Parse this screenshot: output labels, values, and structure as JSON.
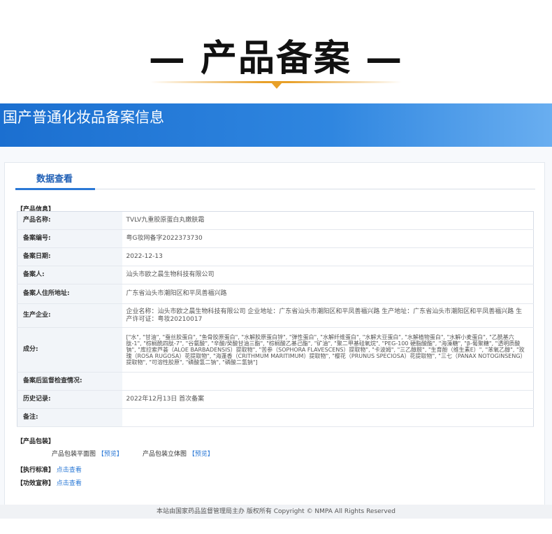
{
  "hero": {
    "title": "— 产品备案 —"
  },
  "banner": {
    "title": "国产普通化妆品备案信息"
  },
  "tab": {
    "label": "数据查看"
  },
  "product_section": {
    "label": "【产品信息】"
  },
  "table": [
    {
      "key": "产品名称:",
      "value": "TVLV九重胶原蛋白丸嫩肤霜"
    },
    {
      "key": "备案编号:",
      "value": "粤G妆网备字2022373730"
    },
    {
      "key": "备案日期:",
      "value": "2022-12-13"
    },
    {
      "key": "备案人:",
      "value": "汕头市欧之晨生物科技有限公司"
    },
    {
      "key": "备案人住所地址:",
      "value": "广东省汕头市潮阳区和平凤善福兴路"
    },
    {
      "key": "生产企业:",
      "value": "企业名称：汕头市欧之晨生物科技有限公司 企业地址：广东省汕头市潮阳区和平凤善福兴路 生产地址：广东省汕头市潮阳区和平凤善福兴路 生产许可证：粤妆20210017"
    },
    {
      "key": "成分:",
      "value": "[\"水\", \"甘油\", \"蚕丝胶蛋白\", \"鱼骨胶原蛋白\", \"水解胶原蛋白锌\", \"弹性蛋白\", \"水解纤维蛋白\", \"水解大豆蛋白\", \"水解植物蛋白\", \"水解小麦蛋白\", \"乙酰基六肽-1\", \"棕榈酰四肽-7\", \"谷氨酸\", \"辛酸/癸酸甘油三酯\", \"棕榈酸乙基己酯\", \"矿油\", \"聚二甲基硅氧烷\", \"PEG-100 硬脂酸酯\", \"海藻糖\", \"β-葡聚糖\", \"透明质酸钠\", \"库拉索芦荟（ALOE BARBADENSIS）提取物\", \"苦参（SOPHORA FLAVESCENS）提取物\", \"卡波姆\", \"三乙醇胺\", \"生育酚（维生素E）\", \"苯氧乙醇\", \"玫瑰（ROSA RUGOSA）花提取物\", \"海蓬香（CRITHMUM MARITIMUM）提取物\", \"樱花（PRUNUS SPECIOSA）花提取物\", \"三七（PANAX NOTOGINSENG）提取物\", \"可溶性胶原\", \"磷酸氢二钠\", \"磷酸二氢钠\"]"
    },
    {
      "key": "备案后监督检查情况:",
      "value": ""
    },
    {
      "key": "历史记录:",
      "value": "2022年12月13日 首次备案"
    },
    {
      "key": "备注:",
      "value": ""
    }
  ],
  "packaging": {
    "label": "【产品包装】",
    "flat_label": "产品包装平面图",
    "flat_link": "【预览】",
    "solid_label": "产品包装立体图",
    "solid_link": "【预览】"
  },
  "standard": {
    "label": "【执行标准】",
    "link": "点击查看"
  },
  "efficacy": {
    "label": "【功效宣称】",
    "link": "点击查看"
  },
  "footer": {
    "text": "本站由国家药品监督管理局主办 版权所有 Copyright © NMPA All Rights Reserved"
  },
  "colors": {
    "accent": "#e8a028",
    "banner": "#1b6fd0",
    "link": "#2a78d6"
  }
}
